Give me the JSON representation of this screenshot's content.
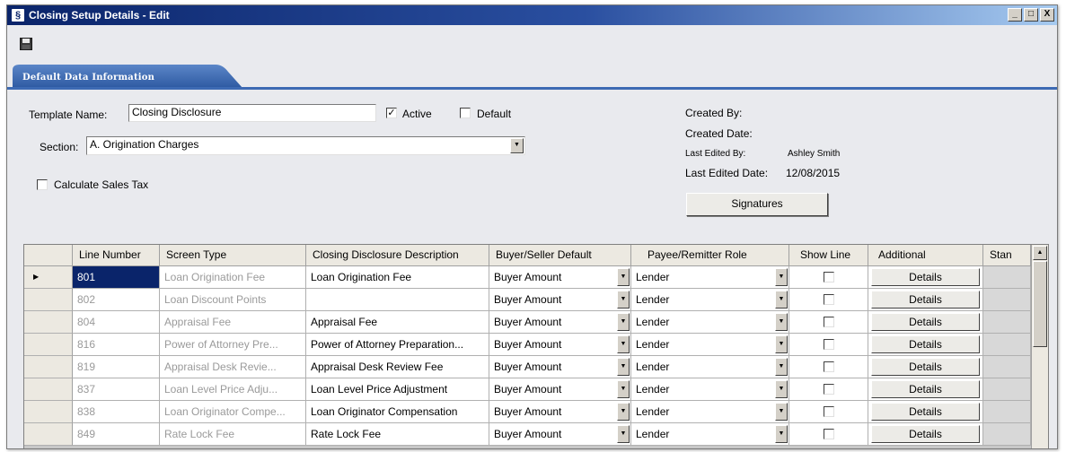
{
  "window": {
    "title": "Closing Setup Details - Edit",
    "controls": {
      "minimize": "_",
      "maximize": "□",
      "close": "X"
    }
  },
  "tab": {
    "label": "Default Data Information"
  },
  "form": {
    "template_name_label": "Template Name:",
    "template_name_value": "Closing Disclosure",
    "active_label": "Active",
    "active_checked": true,
    "default_label": "Default",
    "default_checked": false,
    "section_label": "Section:",
    "section_value": "A. Origination Charges",
    "calc_sales_tax_label": "Calculate Sales Tax",
    "calc_sales_tax_checked": false
  },
  "meta": {
    "created_by_label": "Created By:",
    "created_date_label": "Created Date:",
    "last_edited_by_label": "Last Edited By:",
    "last_edited_by_value": "Ashley Smith",
    "last_edited_date_label": "Last Edited Date:",
    "last_edited_date_value": "12/08/2015",
    "signatures_button": "Signatures"
  },
  "grid": {
    "columns": [
      "Line Number",
      "Screen Type",
      "Closing Disclosure Description",
      "Buyer/Seller Default",
      "Payee/Remitter Role",
      "Show Line",
      "Additional",
      "Stan"
    ],
    "rows": [
      {
        "line": "801",
        "screen_type": "Loan Origination Fee",
        "description": "Loan Origination Fee",
        "buyer_seller": "Buyer Amount",
        "payee": "Lender",
        "show_line": false,
        "additional": "Details",
        "selected": true
      },
      {
        "line": "802",
        "screen_type": "Loan Discount Points",
        "description": "",
        "buyer_seller": "Buyer Amount",
        "payee": "Lender",
        "show_line": false,
        "additional": "Details",
        "selected": false
      },
      {
        "line": "804",
        "screen_type": "Appraisal Fee",
        "description": "Appraisal Fee",
        "buyer_seller": "Buyer Amount",
        "payee": "Lender",
        "show_line": false,
        "additional": "Details",
        "selected": false
      },
      {
        "line": "816",
        "screen_type": "Power of Attorney Pre...",
        "description": "Power of Attorney Preparation...",
        "buyer_seller": "Buyer Amount",
        "payee": "Lender",
        "show_line": false,
        "additional": "Details",
        "selected": false
      },
      {
        "line": "819",
        "screen_type": "Appraisal Desk Revie...",
        "description": "Appraisal Desk Review Fee",
        "buyer_seller": "Buyer Amount",
        "payee": "Lender",
        "show_line": false,
        "additional": "Details",
        "selected": false
      },
      {
        "line": "837",
        "screen_type": "Loan Level Price Adju...",
        "description": "Loan Level Price Adjustment",
        "buyer_seller": "Buyer Amount",
        "payee": "Lender",
        "show_line": false,
        "additional": "Details",
        "selected": false
      },
      {
        "line": "838",
        "screen_type": "Loan Originator Compe...",
        "description": "Loan Originator Compensation",
        "buyer_seller": "Buyer Amount",
        "payee": "Lender",
        "show_line": false,
        "additional": "Details",
        "selected": false
      },
      {
        "line": "849",
        "screen_type": "Rate Lock Fee",
        "description": "Rate Lock Fee",
        "buyer_seller": "Buyer Amount",
        "payee": "Lender",
        "show_line": false,
        "additional": "Details",
        "selected": false
      }
    ]
  },
  "icons": {
    "app": "app-icon",
    "save": "floppy-disk-icon",
    "dropdown": "triangle-down-icon",
    "row_selector": "triangle-right-icon",
    "scroll_up": "triangle-up-icon"
  },
  "colors": {
    "titlebar_start": "#0a246a",
    "titlebar_end": "#a6caf0",
    "tab": "#3d6ab3",
    "selection": "#0a246a"
  }
}
